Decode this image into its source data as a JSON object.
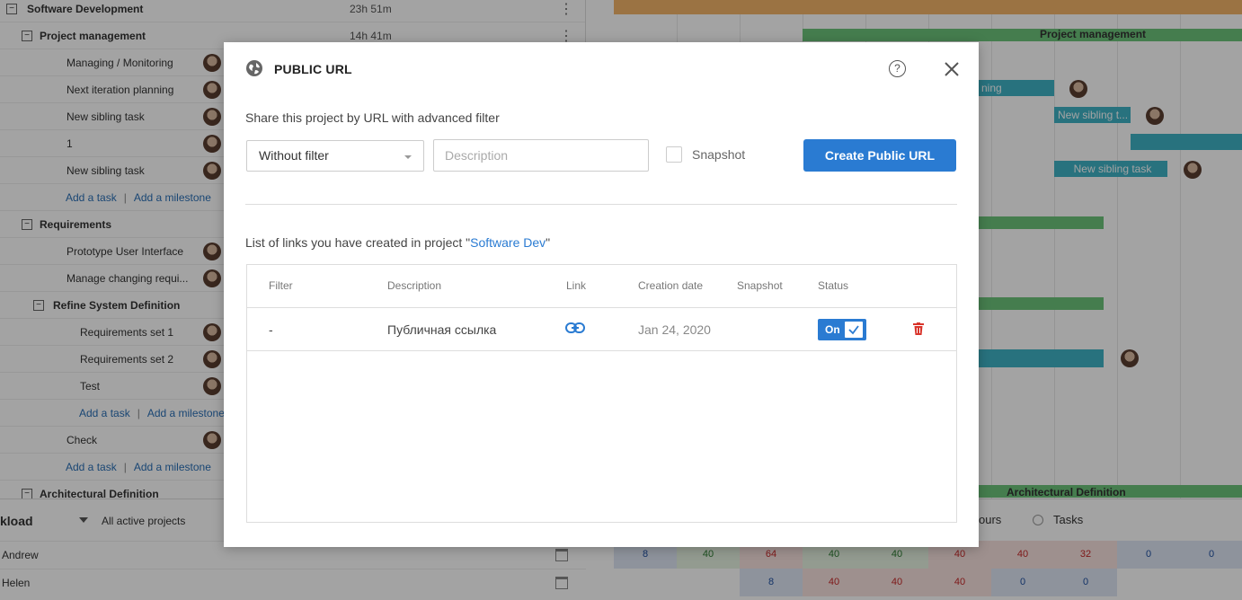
{
  "tree": {
    "rows": [
      {
        "name": "Software Development",
        "duration": "23h 51m"
      },
      {
        "name": "Project management",
        "duration": "14h 41m"
      },
      {
        "name": "Managing / Monitoring"
      },
      {
        "name": "Next iteration planning"
      },
      {
        "name": "New sibling task"
      },
      {
        "name": "1"
      },
      {
        "name": "New sibling task"
      },
      {
        "name": "Requirements"
      },
      {
        "name": "Prototype User Interface"
      },
      {
        "name": "Manage changing requi..."
      },
      {
        "name": "Refine System Definition"
      },
      {
        "name": "Requirements set 1"
      },
      {
        "name": "Requirements set 2"
      },
      {
        "name": "Test"
      },
      {
        "name": "Check"
      },
      {
        "name": "Architectural Definition"
      }
    ],
    "add_task": "Add a task",
    "add_milestone": "Add a milestone",
    "toggle_symbol": "−"
  },
  "gantt": {
    "labels": {
      "project_management": "Project management",
      "planning_partial": "ning",
      "new_sibling_short": "New sibling t...",
      "new_sibling_task": "New sibling task",
      "architectural_definition": "Architectural Definition"
    }
  },
  "workload": {
    "title": "kload",
    "filter": "All active projects",
    "hours_label": "ours",
    "tasks_label": "Tasks",
    "people": [
      {
        "name": "Andrew",
        "values": [
          "8",
          "40",
          "64",
          "40",
          "40",
          "40",
          "40",
          "32",
          "0",
          "0"
        ]
      },
      {
        "name": "Helen",
        "values": [
          "",
          "",
          "8",
          "40",
          "40",
          "40",
          "0",
          "0",
          "",
          ""
        ]
      }
    ]
  },
  "modal": {
    "title": "PUBLIC URL",
    "help_symbol": "?",
    "subtitle": "Share this project by URL with advanced filter",
    "filter_select": "Without filter",
    "description_placeholder": "Description",
    "snapshot_label": "Snapshot",
    "create_button": "Create Public URL",
    "list_title_prefix": "List of links you have created in project \"",
    "project_name": "Software Dev",
    "list_title_suffix": "\"",
    "table": {
      "headers": {
        "filter": "Filter",
        "description": "Description",
        "link": "Link",
        "creation_date": "Creation date",
        "snapshot": "Snapshot",
        "status": "Status"
      },
      "rows": [
        {
          "filter": "-",
          "description": "Публичная ссылка",
          "creation_date": "Jan 24, 2020",
          "snapshot": "",
          "status": "On"
        }
      ]
    }
  },
  "colors": {
    "accent": "#2a7bd2",
    "danger": "#d9342b",
    "teal_bar": "#3fb3c6",
    "green_bar": "#6cc47a",
    "orange_bar": "#f2b56a"
  }
}
